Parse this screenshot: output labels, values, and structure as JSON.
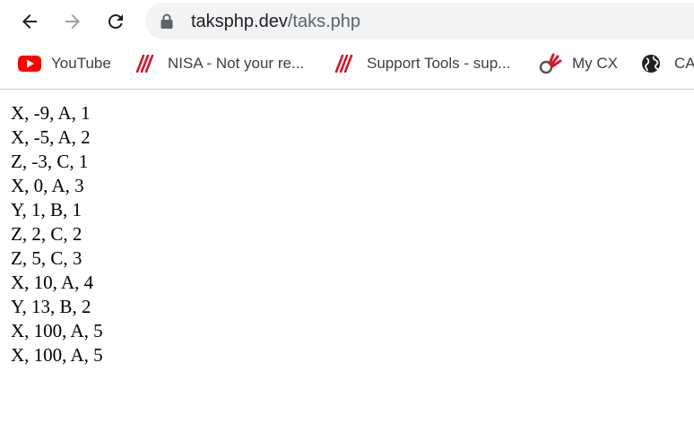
{
  "browser": {
    "url_host": "taksphp.dev",
    "url_path": "/taks.php"
  },
  "bookmarks": [
    {
      "label": "YouTube",
      "icon": "youtube-icon"
    },
    {
      "label": "NISA - Not your re...",
      "icon": "nisa-icon"
    },
    {
      "label": "Support Tools - sup...",
      "icon": "support-tools-icon"
    },
    {
      "label": "My CX",
      "icon": "mycx-icon"
    },
    {
      "label": "CA",
      "icon": "globe-icon"
    }
  ],
  "colors": {
    "youtube_red": "#ff0000",
    "nisa_red": "#d0192c",
    "chrome_gray": "#5f6368"
  },
  "content": {
    "lines": [
      "X, -9, A, 1",
      "X, -5, A, 2",
      "Z, -3, C, 1",
      "X, 0, A, 3",
      "Y, 1, B, 1",
      "Z, 2, C, 2",
      "Z, 5, C, 3",
      "X, 10, A, 4",
      "Y, 13, B, 2",
      "X, 100, A, 5",
      "X, 100, A, 5"
    ]
  }
}
